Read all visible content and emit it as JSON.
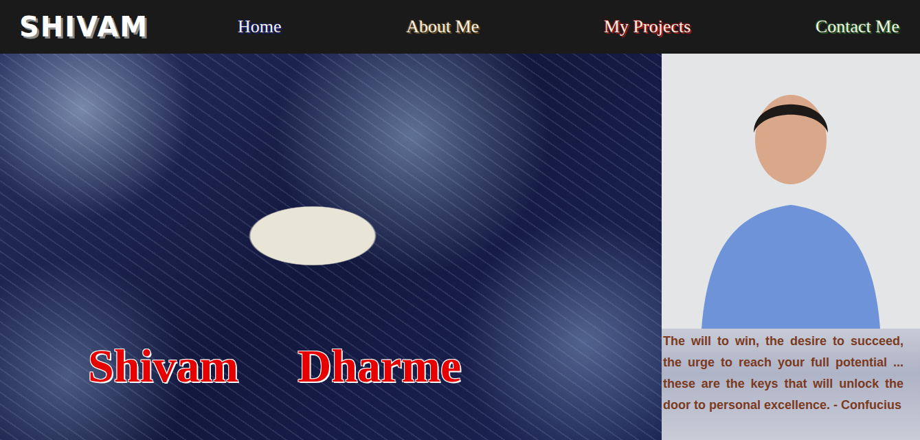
{
  "logo": "SHIVAM",
  "nav": [
    {
      "label": "Home",
      "color": "#1a237e"
    },
    {
      "label": "About Me",
      "color": "#7a5a2a"
    },
    {
      "label": "My Projects",
      "color": "#b71c1c"
    },
    {
      "label": "Contact Me",
      "color": "#2e6b2e"
    }
  ],
  "hero": {
    "name": [
      "Shivam",
      "Dharme"
    ],
    "quote": "The will to win, the desire to succeed, the urge to reach your full potential ... these are the keys that will unlock the door to personal excellence. - Confucius"
  }
}
